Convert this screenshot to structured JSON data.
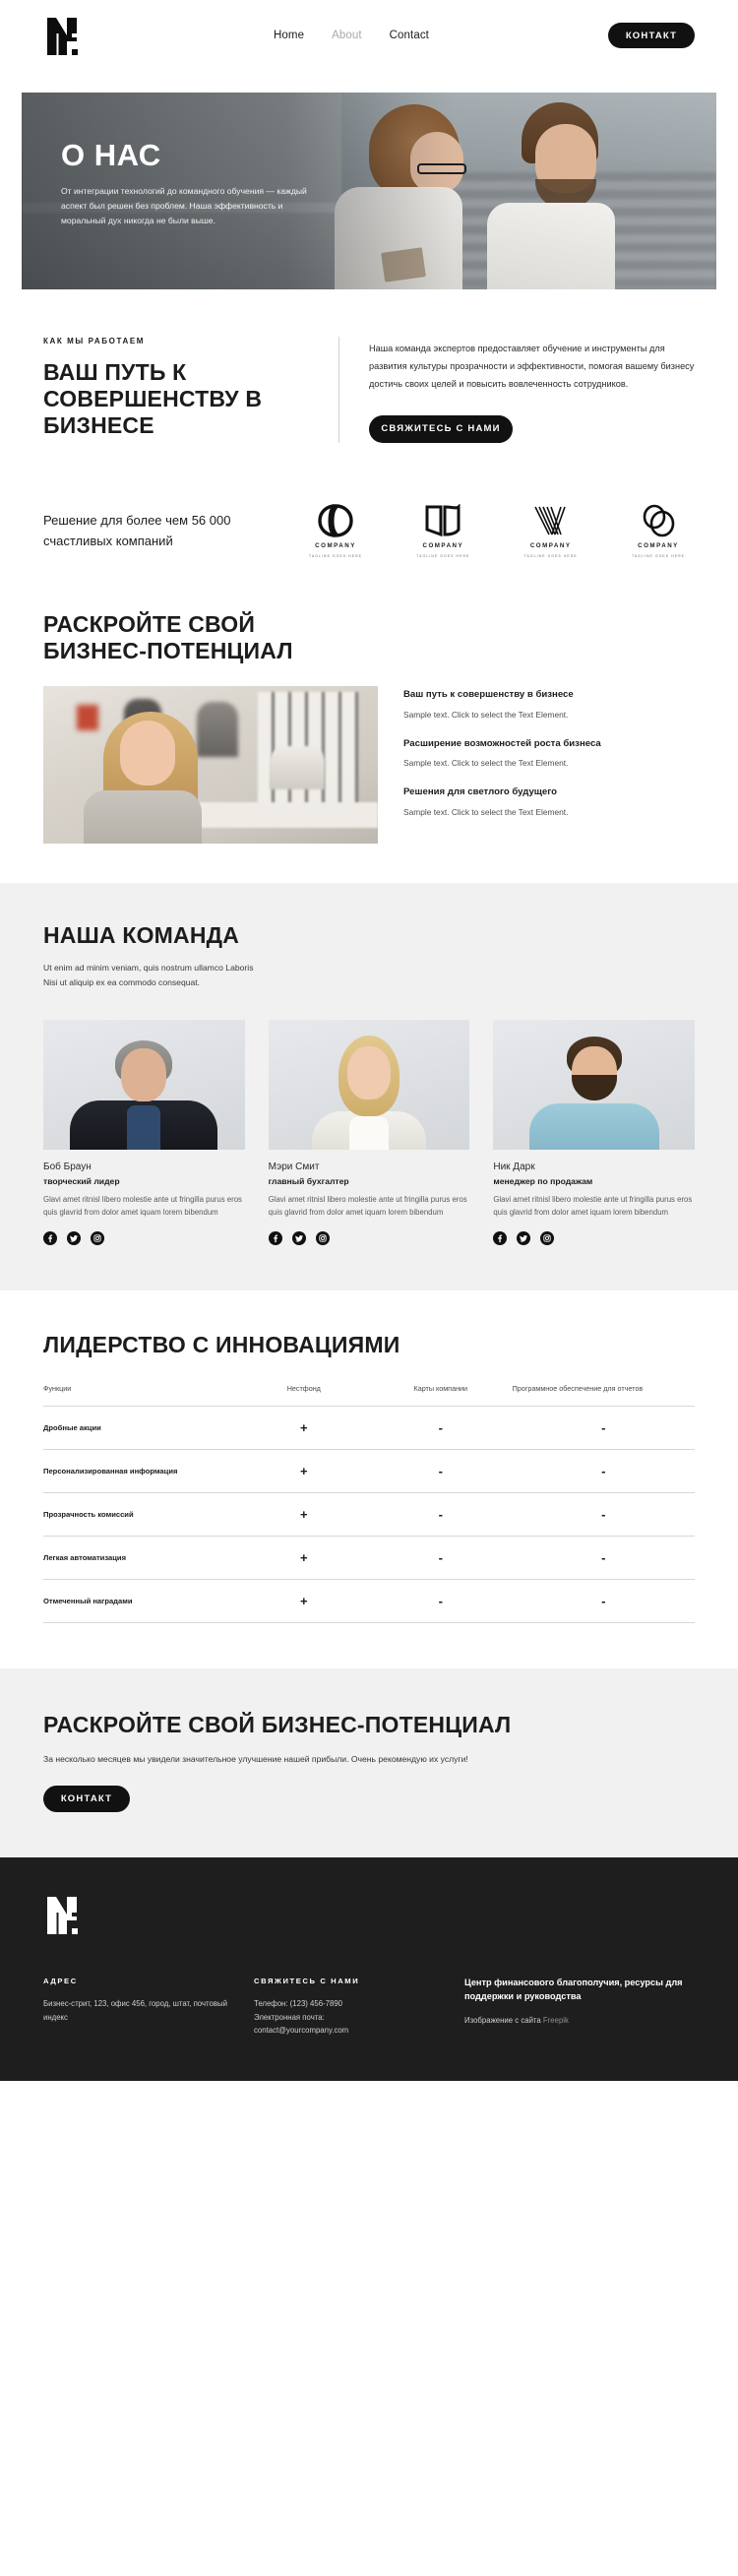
{
  "brand": {
    "logo_alt": "M",
    "logo_letter": "M"
  },
  "header": {
    "nav": [
      {
        "label": "Home",
        "muted": false
      },
      {
        "label": "About",
        "muted": true
      },
      {
        "label": "Contact",
        "muted": false
      }
    ],
    "cta_label": "КОНТАКТ"
  },
  "hero": {
    "title": "О НАС",
    "subtitle": "От интеграции технологий до командного обучения — каждый аспект был решен без проблем. Наша эффективность и моральный дух никогда не были выше."
  },
  "howwork": {
    "eyebrow": "КАК МЫ РАБОТАЕМ",
    "heading": "ВАШ ПУТЬ К СОВЕРШЕНСТВУ В БИЗНЕСЕ",
    "paragraph": "Наша команда экспертов предоставляет обучение и инструменты для развития культуры прозрачности и эффективности, помогая вашему бизнесу достичь своих целей и повысить вовлеченность сотрудников.",
    "button_label": "СВЯЖИТЕСЬ С НАМИ"
  },
  "clients": {
    "lead": "Решение для более чем 56 000 счастливых компаний",
    "logos": [
      {
        "name": "COMPANY",
        "tagline": "TAGLINE GOES HERE",
        "mark": "infinity-loop-logo"
      },
      {
        "name": "COMPANY",
        "tagline": "TAGLINE GOES HERE",
        "mark": "book-pages-logo"
      },
      {
        "name": "COMPANY",
        "tagline": "TAGLINE GOES HERE",
        "mark": "striped-chevron-logo"
      },
      {
        "name": "COMPANY",
        "tagline": "TAGLINE GOES HERE",
        "mark": "double-ring-logo"
      }
    ]
  },
  "potential": {
    "heading": "РАСКРОЙТЕ СВОЙ БИЗНЕС-ПОТЕНЦИАЛ",
    "photo_alt": "Улыбающаяся деловая женщина в офисе",
    "items": [
      {
        "title": "Ваш путь к совершенству в бизнесе",
        "desc": "Sample text. Click to select the Text Element."
      },
      {
        "title": "Расширение возможностей роста бизнеса",
        "desc": "Sample text. Click to select the Text Element."
      },
      {
        "title": "Решения для светлого будущего",
        "desc": "Sample text. Click to select the Text Element."
      }
    ]
  },
  "team": {
    "heading": "НАША КОМАНДА",
    "subtitle_line1": "Ut enim ad minim veniam, quis nostrum ullamco Laboris",
    "subtitle_line2": "Nisi ut aliquip ex ea commodo consequat.",
    "members": [
      {
        "name": "Боб Браун",
        "role": "творческий лидер",
        "bio": "Glavi amet ritnisl libero molestie ante ut fringilla purus eros quis glavrid from dolor amet iquam lorem bibendum",
        "socials": [
          "facebook-icon",
          "twitter-icon",
          "instagram-icon"
        ]
      },
      {
        "name": "Мэри Смит",
        "role": "главный бухгалтер",
        "bio": "Glavi amet ritnisl libero molestie ante ut fringilla purus eros quis glavrid from dolor amet iquam lorem bibendum",
        "socials": [
          "facebook-icon",
          "twitter-icon",
          "instagram-icon"
        ]
      },
      {
        "name": "Ник Дарк",
        "role": "менеджер по продажам",
        "bio": "Glavi amet ritnisl libero molestie ante ut fringilla purus eros quis glavrid from dolor amet iquam lorem bibendum",
        "socials": [
          "facebook-icon",
          "twitter-icon",
          "instagram-icon"
        ]
      }
    ]
  },
  "comparison": {
    "heading": "ЛИДЕРСТВО С ИННОВАЦИЯМИ",
    "columns": [
      "Функции",
      "Нестфонд",
      "Карты компании",
      "Программное обеспечение для отчетов"
    ],
    "rows": [
      {
        "feature": "Дробные акции",
        "c1": "+",
        "c2": "-",
        "c3": "-"
      },
      {
        "feature": "Персонализированная информация",
        "c1": "+",
        "c2": "-",
        "c3": "-"
      },
      {
        "feature": "Прозрачность комиссий",
        "c1": "+",
        "c2": "-",
        "c3": "-"
      },
      {
        "feature": "Легкая автоматизация",
        "c1": "+",
        "c2": "-",
        "c3": "-"
      },
      {
        "feature": "Отмеченный наградами",
        "c1": "+",
        "c2": "-",
        "c3": "-"
      }
    ]
  },
  "cta": {
    "heading": "РАСКРОЙТЕ СВОЙ БИЗНЕС-ПОТЕНЦИАЛ",
    "text": "За несколько месяцев мы увидели значительное улучшение нашей прибыли. Очень рекомендую их услуги!",
    "button_label": "КОНТАКТ"
  },
  "footer": {
    "address_head": "АДРЕС",
    "address_text": "Бизнес-стрит, 123, офис 456, город, штат, почтовый индекс",
    "contact_head": "СВЯЖИТЕСЬ С НАМИ",
    "contact_phone": "Телефон: (123) 456-7890",
    "contact_email_label": "Электронная почта:",
    "contact_email": "contact@yourcompany.com",
    "tagline": "Центр финансового благополучия, ресурсы для поддержки и руководства",
    "credit_prefix": "Изображение с сайта ",
    "credit_link": "Freepik"
  },
  "colors": {
    "accent": "#111111",
    "bg_light": "#f1f1f1",
    "footer_bg": "#1e1e1e",
    "muted_text": "#a9a9a9"
  }
}
